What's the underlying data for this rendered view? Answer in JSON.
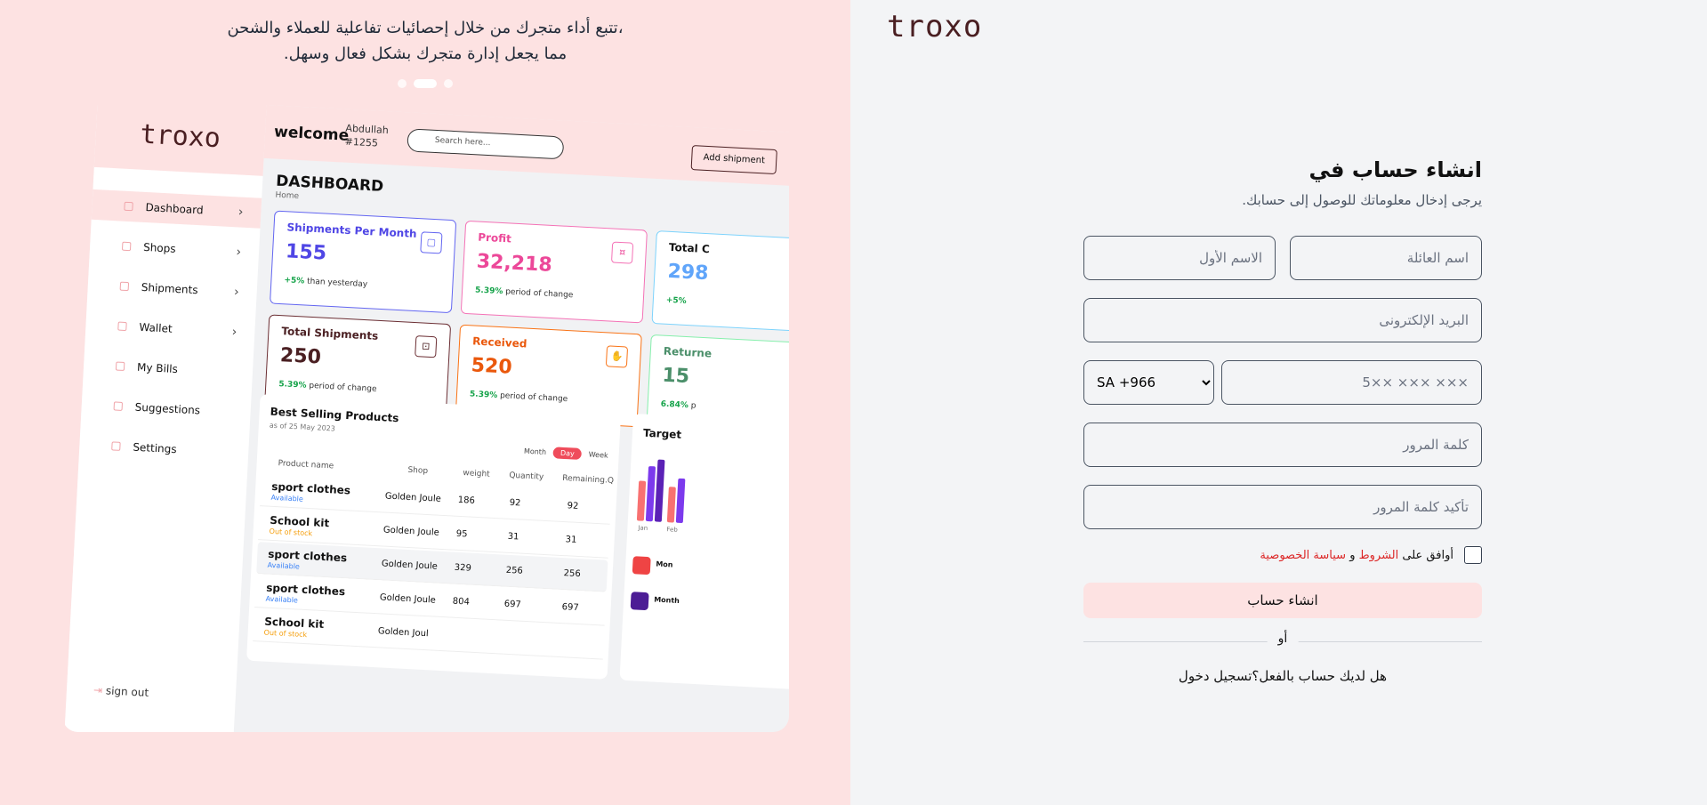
{
  "promo": {
    "caption_line1": "تتبع أداء متجرك من خلال إحصائيات تفاعلية للعملاء والشحن،",
    "caption_line2": ".مما يجعل إدارة متجرك بشكل فعال وسهل",
    "carousel_active_index": 1,
    "mockup": {
      "logo": "troxo",
      "welcome": "welcome",
      "user_name": "Abdullah",
      "user_id": "#1255",
      "search_placeholder": "Search here...",
      "add_shipment": "Add shipment",
      "dashboard_title": "DASHBOARD",
      "breadcrumb": "Home",
      "nav": [
        "Dashboard",
        "Shops",
        "Shipments",
        "Wallet",
        "My Bills",
        "Suggestions",
        "Settings"
      ],
      "sign_out": "sign out",
      "cards": [
        {
          "title": "Shipments Per Month",
          "value": "155",
          "change": "+5%",
          "note": "than yesterday"
        },
        {
          "title": "Profit",
          "value": "32,218",
          "change": "5.39%",
          "note": "period of change"
        },
        {
          "title": "Total C",
          "value": "298",
          "change": "+5%",
          "note": ""
        },
        {
          "title": "Total Shipments",
          "value": "250",
          "change": "5.39%",
          "note": "period of change"
        },
        {
          "title": "Received",
          "value": "520",
          "change": "5.39%",
          "note": "period of change"
        },
        {
          "title": "Returne",
          "value": "15",
          "change": "6.84%",
          "note": "p"
        }
      ],
      "best_selling": {
        "title": "Best Selling Products",
        "subtitle": "as of 25 May 2023",
        "tabs": [
          "Month",
          "Day",
          "Week"
        ],
        "active_tab": "Day",
        "columns": [
          "Product name",
          "Shop",
          "weight",
          "Quantity",
          "Remaining.Q"
        ],
        "rows": [
          {
            "name": "sport clothes",
            "status": "Available",
            "shop": "Golden Joule",
            "weight": "186",
            "qty": "92",
            "rem": "92"
          },
          {
            "name": "School kit",
            "status": "Out of stock",
            "shop": "Golden Joule",
            "weight": "95",
            "qty": "31",
            "rem": "31"
          },
          {
            "name": "sport clothes",
            "status": "Available",
            "shop": "Golden Joule",
            "weight": "329",
            "qty": "256",
            "rem": "256"
          },
          {
            "name": "sport clothes",
            "status": "Available",
            "shop": "Golden Joule",
            "weight": "804",
            "qty": "697",
            "rem": "697"
          },
          {
            "name": "School kit",
            "status": "Out of stock",
            "shop": "Golden Joul",
            "weight": "",
            "qty": "",
            "rem": ""
          }
        ]
      },
      "target": {
        "title": "Target",
        "months": [
          "Jan",
          "Feb"
        ],
        "items": [
          "Mon",
          "Month"
        ]
      }
    }
  },
  "brand": {
    "logo_text": "troxo"
  },
  "form": {
    "title": "انشاء حساب في",
    "subtitle": "يرجى إدخال معلوماتك للوصول إلى حسابك.",
    "first_name_placeholder": "الاسم الأول",
    "last_name_placeholder": "اسم العائلة",
    "email_placeholder": "البريد الإلكترونى",
    "phone_placeholder": "5×× ××× ×××",
    "country_code": "SA +966",
    "password_placeholder": "كلمة المرور",
    "confirm_password_placeholder": "تأكيد كلمة المرور",
    "agree_prefix": "أوافق على",
    "terms": "الشروط",
    "and": "و",
    "privacy": "سياسة الخصوصية",
    "submit": "انشاء حساب",
    "or": "أو",
    "have_account": "هل لديك حساب بالفعل؟تسجيل دخول"
  },
  "colors": {
    "accent_bg": "#fde2e2",
    "brand": "#4a1f22",
    "link": "#dc2626"
  }
}
